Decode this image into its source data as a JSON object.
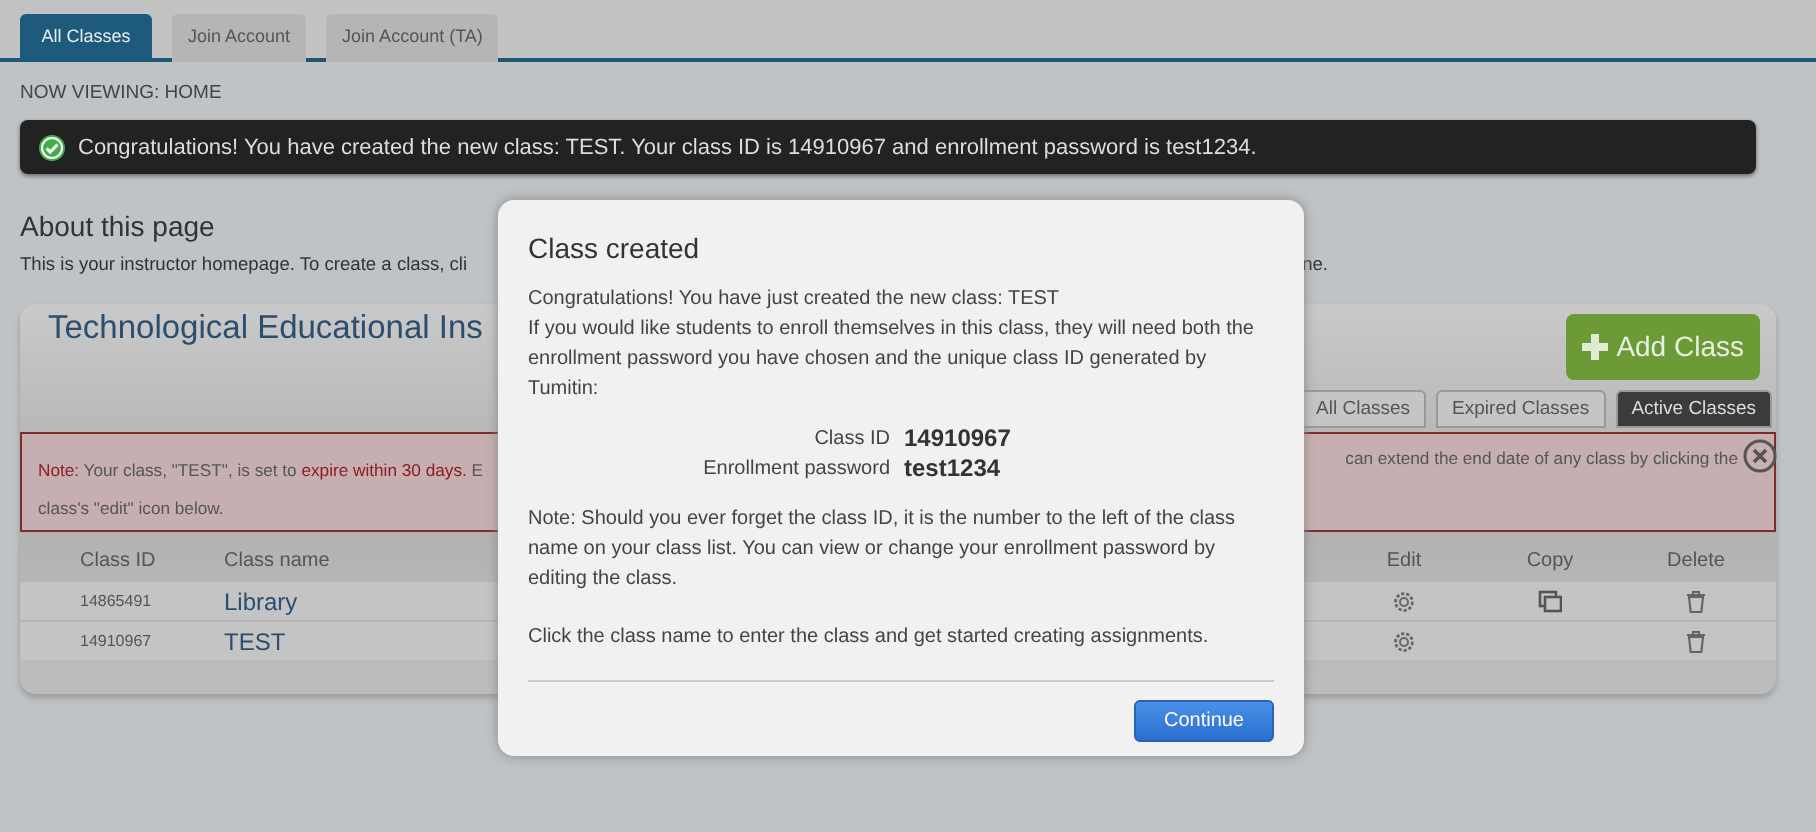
{
  "top_tabs": [
    {
      "label": "All Classes",
      "selected": true
    },
    {
      "label": "Join Account",
      "selected": false
    },
    {
      "label": "Join Account (TA)",
      "selected": false
    }
  ],
  "breadcrumb": "NOW VIEWING: HOME",
  "banner": {
    "text": "Congratulations! You have created the new class: TEST. Your class ID is 14910967 and enrollment password is test1234."
  },
  "about": {
    "heading": "About this page",
    "text_left": "This is your instructor homepage. To create a class, cli",
    "text_right": "ne."
  },
  "panel": {
    "title": "Technological Educational Ins",
    "add_button": "Add Class",
    "filter_tabs": [
      {
        "label": "All Classes",
        "selected": false
      },
      {
        "label": "Expired Classes",
        "selected": false
      },
      {
        "label": "Active Classes",
        "selected": true
      }
    ],
    "note": {
      "left": [
        {
          "text": "Note:",
          "highlight": true
        },
        {
          "text": " Your class, \"TEST\", is set to ",
          "highlight": false
        },
        {
          "text": "expire within 30 days.",
          "highlight": true
        },
        {
          "text": " E",
          "highlight": false
        }
      ],
      "right": "can extend the end date of any class by clicking the",
      "second_line": "class's \"edit\" icon below."
    },
    "columns": [
      "Class ID",
      "Class name",
      "Edit",
      "Copy",
      "Delete"
    ],
    "rows": [
      {
        "class_id": "14865491",
        "class_name": "Library",
        "copy": true
      },
      {
        "class_id": "14910967",
        "class_name": "TEST",
        "copy": false
      }
    ]
  },
  "dialog": {
    "title": "Class created",
    "intro": [
      "Congratulations! You have just created the new class: TEST",
      "If you would like students to enroll themselves in this class, they will need both the enrollment password you have chosen and the unique class ID generated by Tumitin:"
    ],
    "fields": [
      {
        "label": "Class ID",
        "value": "14910967"
      },
      {
        "label": "Enrollment password",
        "value": "test1234"
      }
    ],
    "note": "Note: Should you ever forget the class ID, it is the number to the left of the class name on your class list. You can view or change your enrollment password by editing the class.",
    "hint": "Click the class name to enter the class and get started creating assignments.",
    "button": "Continue"
  }
}
